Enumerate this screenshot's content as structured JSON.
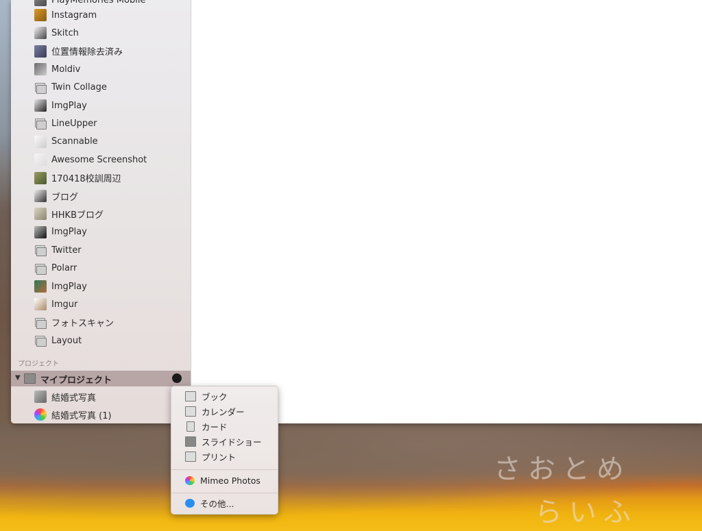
{
  "sidebar": {
    "truncated_top_item": "PlayMemories Mobile",
    "albums": [
      {
        "label": "Instagram",
        "icon": "photo-thumbnail-icon"
      },
      {
        "label": "Skitch",
        "icon": "photo-thumbnail-icon"
      },
      {
        "label": "位置情報除去済み",
        "icon": "photo-thumbnail-icon"
      },
      {
        "label": "Moldiv",
        "icon": "photo-thumbnail-icon"
      },
      {
        "label": "Twin Collage",
        "icon": "album-icon"
      },
      {
        "label": "ImgPlay",
        "icon": "photo-thumbnail-icon"
      },
      {
        "label": "LineUpper",
        "icon": "album-icon"
      },
      {
        "label": "Scannable",
        "icon": "photo-thumbnail-icon"
      },
      {
        "label": "Awesome Screenshot",
        "icon": "photo-thumbnail-icon"
      },
      {
        "label": "170418校訓周辺",
        "icon": "photo-thumbnail-icon"
      },
      {
        "label": "ブログ",
        "icon": "photo-thumbnail-icon"
      },
      {
        "label": "HHKBブログ",
        "icon": "photo-thumbnail-icon"
      },
      {
        "label": "ImgPlay",
        "icon": "photo-thumbnail-icon"
      },
      {
        "label": "Twitter",
        "icon": "album-icon"
      },
      {
        "label": "Polarr",
        "icon": "album-icon"
      },
      {
        "label": "ImgPlay",
        "icon": "photo-thumbnail-icon"
      },
      {
        "label": "Imgur",
        "icon": "photo-thumbnail-icon"
      },
      {
        "label": "フォトスキャン",
        "icon": "album-icon"
      },
      {
        "label": "Layout",
        "icon": "album-icon"
      }
    ],
    "projects_section": "プロジェクト",
    "project_folder": "マイプロジェクト",
    "project_items": [
      {
        "label": "結婚式写真",
        "icon": "book-icon"
      },
      {
        "label": "結婚式写真 (1)",
        "icon": "mimeo-icon"
      }
    ]
  },
  "create_menu": {
    "items": [
      {
        "label": "ブック",
        "icon": "book-icon"
      },
      {
        "label": "カレンダー",
        "icon": "calendar-icon"
      },
      {
        "label": "カード",
        "icon": "card-icon"
      },
      {
        "label": "スライドショー",
        "icon": "slideshow-icon"
      },
      {
        "label": "プリント",
        "icon": "print-icon"
      }
    ],
    "extensions": [
      {
        "label": "Mimeo Photos",
        "icon": "mimeo-icon"
      }
    ],
    "more": {
      "label": "その他...",
      "icon": "app-store-icon"
    }
  },
  "watermark": {
    "line1": "さおとめ",
    "line2": "らいふ"
  },
  "colors": {
    "selected_row": "#b8a6a6",
    "sidebar_bg": "#ecebee"
  }
}
